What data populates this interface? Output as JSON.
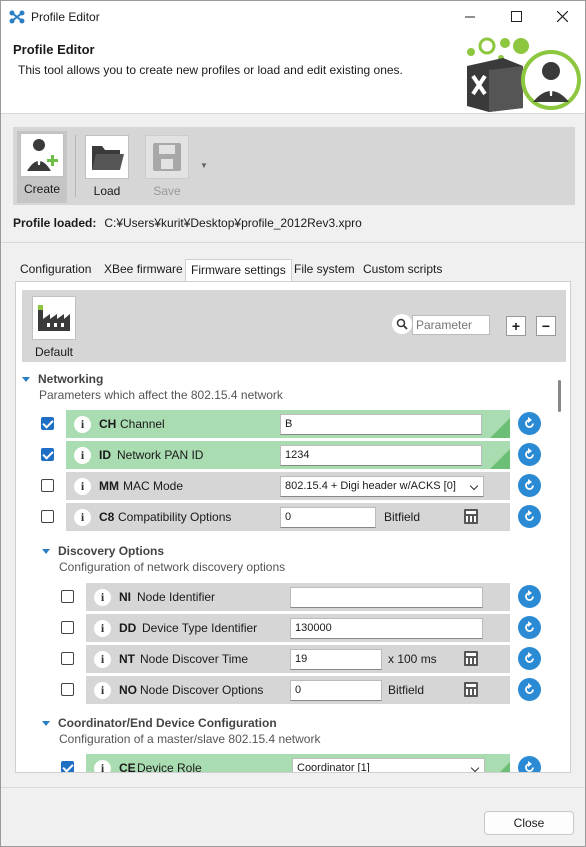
{
  "window": {
    "title": "Profile Editor"
  },
  "header": {
    "title": "Profile Editor",
    "description": "This tool allows you to create new profiles or load and edit existing ones."
  },
  "toolbar": {
    "create": "Create",
    "load": "Load",
    "save": "Save"
  },
  "profile": {
    "label": "Profile loaded:",
    "path": "C:¥Users¥kurit¥Desktop¥profile_2012Rev3.xpro"
  },
  "tabs": [
    "Configuration",
    "XBee firmware",
    "Firmware settings",
    "File system",
    "Custom scripts"
  ],
  "active_tab": "Firmware settings",
  "param_toolbar": {
    "default_label": "Default",
    "search_placeholder": "Parameter"
  },
  "sections": {
    "networking": {
      "title": "Networking",
      "desc": "Parameters which affect the 802.15.4 network",
      "params": [
        {
          "code": "CH",
          "name": "Channel",
          "value": "B",
          "checked": true
        },
        {
          "code": "ID",
          "name": "Network PAN ID",
          "value": "1234",
          "checked": true
        },
        {
          "code": "MM",
          "name": "MAC Mode",
          "value": "802.15.4 + Digi header w/ACKS [0]",
          "checked": false
        },
        {
          "code": "C8",
          "name": "Compatibility Options",
          "value": "0",
          "unit": "Bitfield",
          "checked": false
        }
      ]
    },
    "discovery": {
      "title": "Discovery Options",
      "desc": "Configuration of network discovery options",
      "params": [
        {
          "code": "NI",
          "name": "Node Identifier",
          "value": "",
          "checked": false
        },
        {
          "code": "DD",
          "name": "Device Type Identifier",
          "value": "130000",
          "checked": false
        },
        {
          "code": "NT",
          "name": "Node Discover Time",
          "value": "19",
          "unit": "x 100 ms",
          "checked": false
        },
        {
          "code": "NO",
          "name": "Node Discover Options",
          "value": "0",
          "unit": "Bitfield",
          "checked": false
        }
      ]
    },
    "coordinator": {
      "title": "Coordinator/End Device Configuration",
      "desc": "Configuration of a master/slave 802.15.4 network",
      "params": [
        {
          "code": "CE",
          "name": "Device Role",
          "value": "Coordinator [1]",
          "checked": true
        }
      ]
    }
  },
  "footer": {
    "close": "Close"
  },
  "colors": {
    "accent": "#2a8ad4",
    "changed_row": "#a9dcb0",
    "row": "#d6d6d6",
    "toolbar": "#d6d6d6"
  }
}
